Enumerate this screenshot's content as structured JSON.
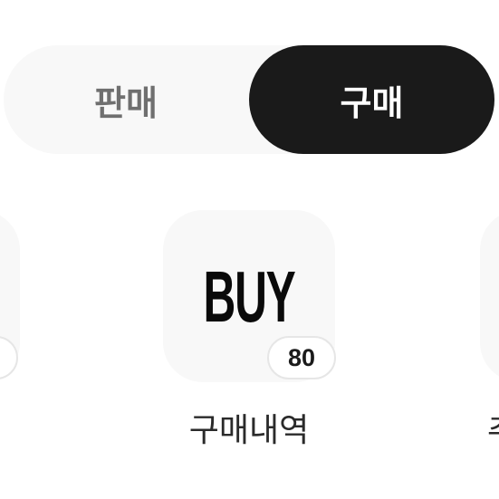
{
  "tabs": {
    "sell_label": "판매",
    "buy_label": "구매",
    "active": "구매"
  },
  "cards": {
    "center": {
      "icon_text": "BUY",
      "badge": "80",
      "label": "구매내역"
    },
    "left": {
      "badge": ""
    },
    "right": {
      "label_partial": "추"
    }
  },
  "colors": {
    "active_tab_bg": "#1a1a1a",
    "inactive_tab_text": "#6f6f6f",
    "card_bg": "#f8f8f8"
  }
}
